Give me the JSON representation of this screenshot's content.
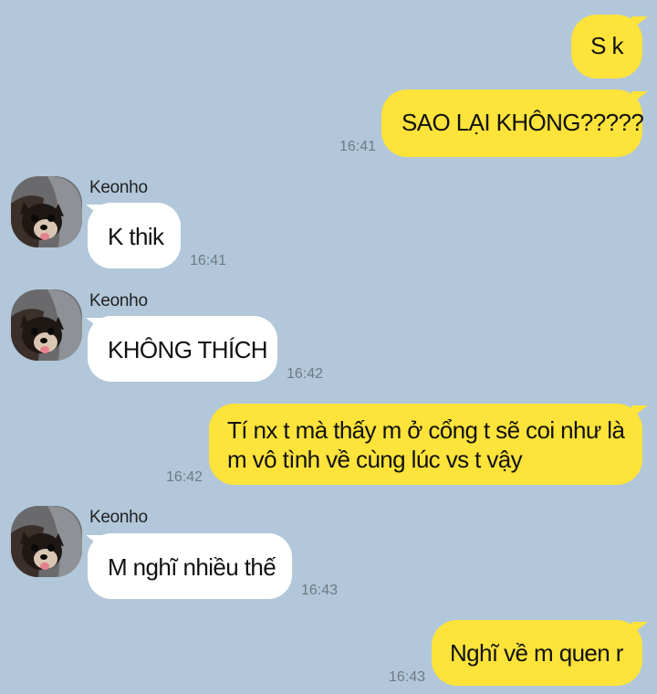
{
  "contact": {
    "name": "Keonho"
  },
  "messages": [
    {
      "sender": "me",
      "text": "S k"
    },
    {
      "sender": "me",
      "text": "SAO LẠI KHÔNG?????",
      "time": "16:41"
    },
    {
      "sender": "them",
      "name": "Keonho",
      "text": "K thik",
      "time": "16:41"
    },
    {
      "sender": "them",
      "name": "Keonho",
      "text": "KHÔNG THÍCH",
      "time": "16:42"
    },
    {
      "sender": "me",
      "line1": "Tí nx t mà thấy m ở cổng t sẽ coi như là",
      "line2": "m vô tình về cùng lúc vs t vậy",
      "time": "16:42"
    },
    {
      "sender": "them",
      "name": "Keonho",
      "text": "M nghĩ nhiều thế",
      "time": "16:43"
    },
    {
      "sender": "me",
      "text": "Nghĩ về m quen r",
      "time": "16:43"
    }
  ],
  "colors": {
    "background": "#b2c7d9",
    "my_bubble": "#fee33a",
    "their_bubble": "#ffffff",
    "timestamp": "#6e7a85"
  },
  "icons": {
    "avatar": "dog-profile-photo"
  }
}
